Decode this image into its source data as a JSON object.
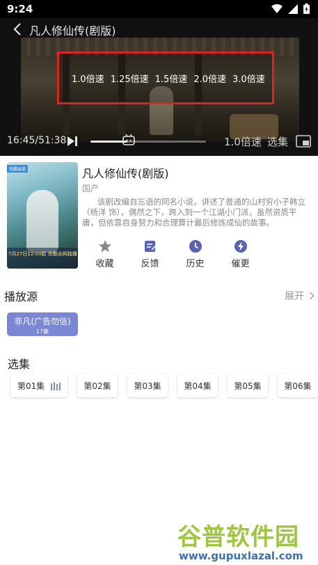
{
  "status_bar": {
    "time": "9:24"
  },
  "player": {
    "title": "凡人修仙传(剧版)",
    "speed_options": [
      "1.0倍速",
      "1.25倍速",
      "1.5倍速",
      "2.0倍速",
      "3.0倍速"
    ],
    "time_display": "16:45/51:38",
    "progress_fraction": 0.32,
    "speed_label": "1.0倍速",
    "episodes_label": "选集"
  },
  "info": {
    "title": "凡人修仙传(剧版)",
    "region": "国产",
    "description": "该剧改编自忘语的同名小说，讲述了普通的山村穷小子韩立（杨洋 饰），偶然之下，跨入到一个江湖小门派，虽然资质平庸，但依靠自身努力和合理算计最后修炼成仙的故事。",
    "poster_date": "7月27日12:00起 优酷全网独播",
    "actions": [
      {
        "label": "收藏",
        "icon": "star-icon"
      },
      {
        "label": "反馈",
        "icon": "feedback-icon"
      },
      {
        "label": "历史",
        "icon": "clock-icon"
      },
      {
        "label": "催更",
        "icon": "lightning-icon"
      }
    ]
  },
  "source": {
    "title": "播放源",
    "expand": "展开",
    "card_name": "非凡(广告勿信)",
    "card_count": "17集"
  },
  "episodes": {
    "title": "选集",
    "items": [
      "第01集",
      "第02集",
      "第03集",
      "第04集",
      "第05集",
      "第06集"
    ]
  },
  "watermark": {
    "name": "谷普软件园",
    "url": "www.gupuxlazal.com"
  },
  "colors": {
    "speed_highlight": "#e02222",
    "source_card": "#7b86d4",
    "action_icon": "#5b62b3"
  }
}
